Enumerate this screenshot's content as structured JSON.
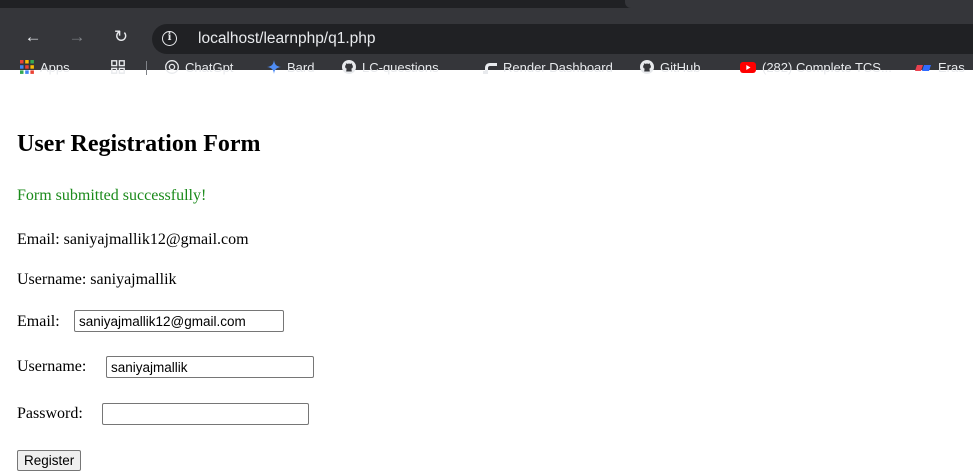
{
  "browser": {
    "url": "localhost/learnphp/q1.php",
    "bookmarks": [
      {
        "label": "Apps",
        "icon": "apps-grid-icon"
      },
      {
        "label": "",
        "icon": "tab-groups-icon"
      },
      {
        "label": "ChatGpt",
        "icon": "chatgpt-icon"
      },
      {
        "label": "Bard",
        "icon": "bard-sparkle-icon"
      },
      {
        "label": "LC-questions",
        "icon": "github-icon"
      },
      {
        "label": "Render Dashboard",
        "icon": "render-icon"
      },
      {
        "label": "GitHub",
        "icon": "github-icon"
      },
      {
        "label": "(282) Complete TCS...",
        "icon": "youtube-icon"
      },
      {
        "label": "Eras",
        "icon": "eraser-icon"
      }
    ]
  },
  "page": {
    "title": "User Registration Form",
    "success_message": "Form submitted successfully!",
    "email_line": "Email: saniyajmallik12@gmail.com",
    "username_line": "Username: saniyajmallik",
    "form": {
      "email_label": "Email:",
      "email_value": "saniyajmallik12@gmail.com",
      "username_label": "Username:",
      "username_value": "saniyajmallik",
      "password_label": "Password:",
      "password_value": "",
      "register_label": "Register"
    }
  },
  "colors": {
    "success": "#1a8a1a",
    "toolbar": "#35363a",
    "omnibox": "#202124"
  }
}
